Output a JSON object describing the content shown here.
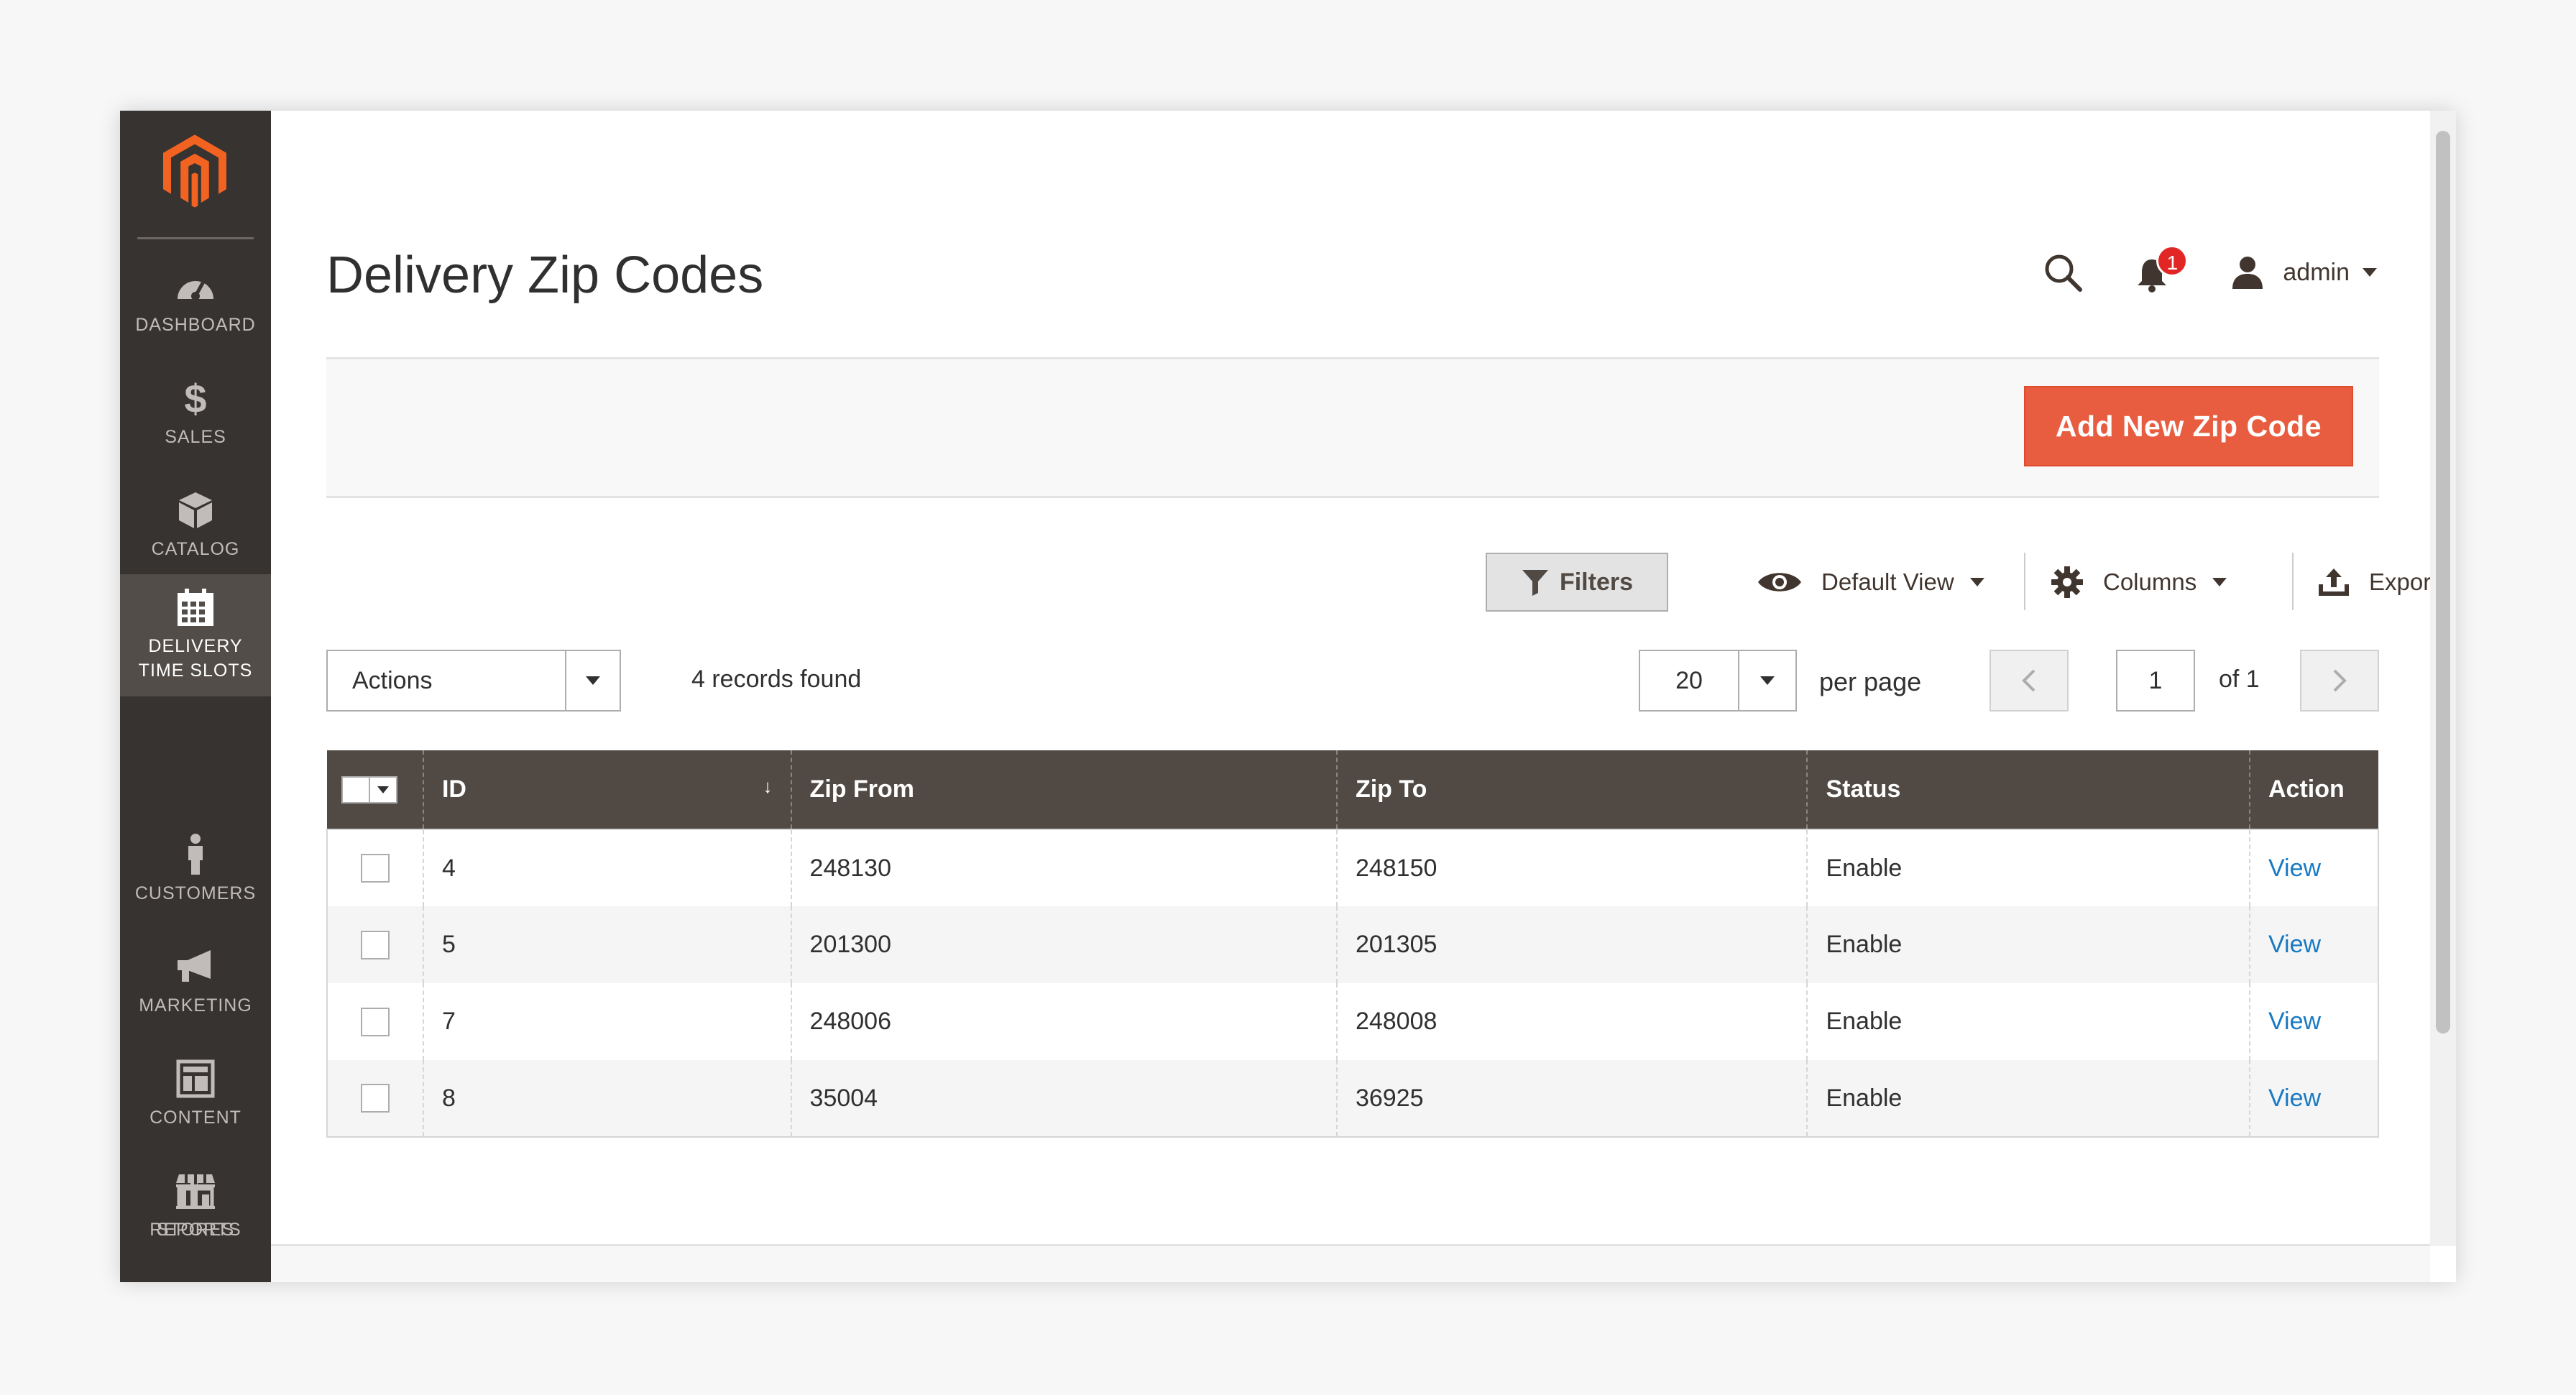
{
  "sidebar": {
    "logo": "magento-logo",
    "items": [
      {
        "label": "DASHBOARD",
        "icon": "dashboard-icon"
      },
      {
        "label": "SALES",
        "icon": "dollar-icon"
      },
      {
        "label": "CATALOG",
        "icon": "box-icon"
      },
      {
        "label": "DELIVERY TIME SLOTS",
        "icon": "calendar-icon",
        "active": true
      },
      {
        "label": "CUSTOMERS",
        "icon": "person-icon"
      },
      {
        "label": "MARKETING",
        "icon": "megaphone-icon"
      },
      {
        "label": "CONTENT",
        "icon": "layout-icon"
      },
      {
        "label": "REPORTS",
        "icon": "bar-chart-icon"
      },
      {
        "label": "STORES",
        "icon": "store-icon"
      }
    ]
  },
  "header": {
    "title": "Delivery Zip Codes",
    "notification_count": "1",
    "user": "admin"
  },
  "page_actions": {
    "add_button": "Add New Zip Code"
  },
  "toolbar": {
    "filters": "Filters",
    "view": "Default View",
    "columns": "Columns",
    "export": "Export",
    "actions": "Actions",
    "records_found": "4 records found",
    "per_page_value": "20",
    "per_page_label": "per page",
    "current_page": "1",
    "page_of": "of 1"
  },
  "grid": {
    "columns": [
      "ID",
      "Zip From",
      "Zip To",
      "Status",
      "Action"
    ],
    "sort_indicator": "↓",
    "rows": [
      {
        "id": "4",
        "zip_from": "248130",
        "zip_to": "248150",
        "status": "Enable",
        "action": "View"
      },
      {
        "id": "5",
        "zip_from": "201300",
        "zip_to": "201305",
        "status": "Enable",
        "action": "View"
      },
      {
        "id": "7",
        "zip_from": "248006",
        "zip_to": "248008",
        "status": "Enable",
        "action": "View"
      },
      {
        "id": "8",
        "zip_from": "35004",
        "zip_to": "36925",
        "status": "Enable",
        "action": "View"
      }
    ]
  },
  "colors": {
    "sidebar_bg": "#373330",
    "sidebar_active": "#524d49",
    "accent": "#e85d3f",
    "grid_header": "#514943",
    "link": "#1979c3",
    "badge": "#e22626"
  }
}
